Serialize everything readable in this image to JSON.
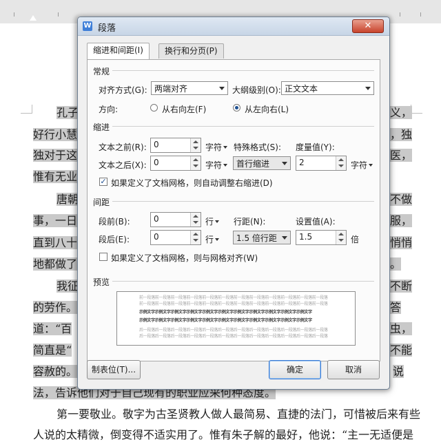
{
  "document": {
    "lines": [
      {
        "left": "孔子",
        "right": "义，"
      },
      {
        "left": "好行小慧",
        "right": "，独"
      },
      {
        "left": "独对于这",
        "right": "医，"
      },
      {
        "left": "惟有无业",
        "right": ""
      },
      {
        "left": "唐朝",
        "right": "不做"
      },
      {
        "left": "事，一日",
        "right": "服，"
      },
      {
        "left": "直到八十",
        "right": "悄悄"
      },
      {
        "left": "地都做了",
        "right": "。"
      },
      {
        "left": "我征",
        "right": "不断"
      },
      {
        "left": "的劳作。",
        "right": "答"
      },
      {
        "left": "道：“百",
        "right": "虫，"
      },
      {
        "left": "简直是“",
        "right": "不能"
      },
      {
        "left": "容赦的。",
        "right": "说"
      },
      {
        "left": "法，告诉他们对于自己现有的职业应采何种态度。",
        "right": ""
      },
      {
        "left": "第一要敬业。敬字为古圣贤教人做人最简易、直捷的法门，可惜被后来有些",
        "right": ""
      },
      {
        "left": "人说的太精微，倒变得不适实用了。惟有朱子解的最好，他说：“主一无适便是",
        "right": ""
      }
    ]
  },
  "dialog": {
    "title": "段落",
    "close_label": "✕",
    "tabs": [
      {
        "label": "缩进和间距(I)",
        "active": true
      },
      {
        "label": "换行和分页(P)",
        "active": false
      }
    ],
    "general": {
      "section": "常规",
      "alignment_label": "对齐方式(G):",
      "alignment_value": "两端对齐",
      "outline_label": "大纲级别(O):",
      "outline_value": "正文文本",
      "direction_label": "方向:",
      "rtl_label": "从右向左(F)",
      "ltr_label": "从左向右(L)",
      "direction_selected": "ltr"
    },
    "indent": {
      "section": "缩进",
      "before_label": "文本之前(R):",
      "before_value": "0",
      "before_unit": "字符",
      "after_label": "文本之后(X):",
      "after_value": "0",
      "after_unit": "字符",
      "special_label": "特殊格式(S):",
      "special_value": "首行缩进",
      "measure_label": "度量值(Y):",
      "measure_value": "2",
      "measure_unit": "字符",
      "grid_checkbox_label": "如果定义了文档网格，则自动调整右缩进(D)",
      "grid_checked": true
    },
    "spacing": {
      "section": "间距",
      "before_label": "段前(B):",
      "before_value": "0",
      "before_unit": "行",
      "after_label": "段后(E):",
      "after_value": "0",
      "after_unit": "行",
      "line_label": "行距(N):",
      "line_value": "1.5 倍行距",
      "setting_label": "设置值(A):",
      "setting_value": "1.5",
      "setting_unit": "倍",
      "grid_checkbox_label": "如果定义了文档网格，则与网格对齐(W)",
      "grid_checked": false
    },
    "preview": {
      "section": "预览",
      "prev_text": "前一段落前一段落前一段落前一段落前一段落前一段落前一段落前一段落前一段落前一段落前一段落前一段落",
      "sample_text": "示例文字示例文字示例文字示例文字示例文字示例文字示例文字示例文字示例文字示例文字示例文字",
      "next_text": "后一段落后一段落后一段落后一段落后一段落后一段落后一段落后一段落后一段落后一段落后一段落后一段落"
    },
    "buttons": {
      "tabs_label": "制表位(T)...",
      "ok_label": "确定",
      "cancel_label": "取消"
    }
  }
}
